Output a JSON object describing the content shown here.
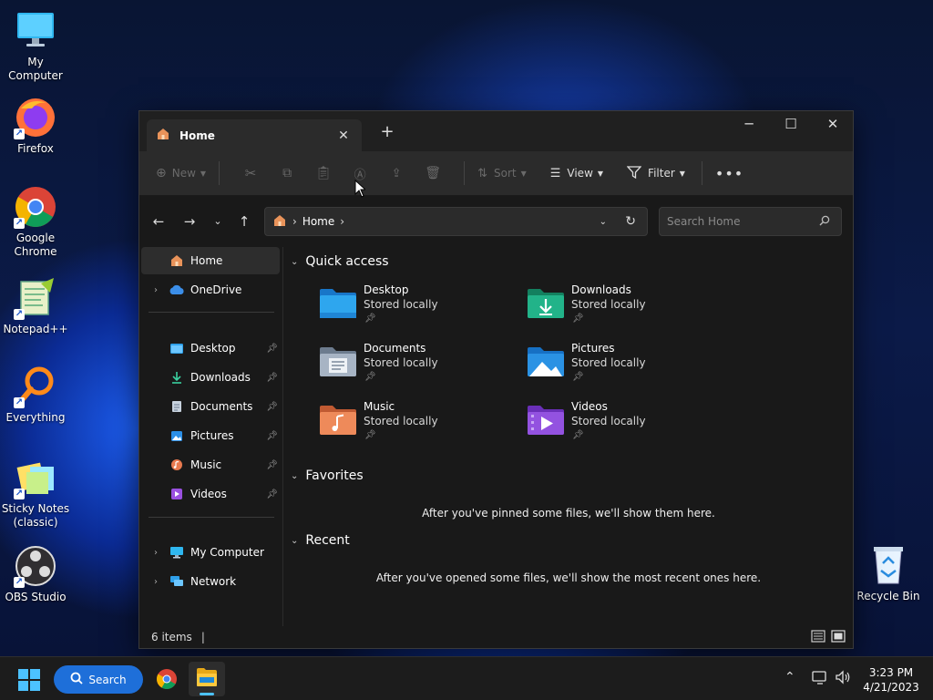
{
  "desktop": {
    "icons": [
      {
        "label": "My Computer",
        "icon": "computer-icon"
      },
      {
        "label": "Firefox",
        "icon": "firefox-icon"
      },
      {
        "label": "Google Chrome",
        "icon": "chrome-icon"
      },
      {
        "label": "Notepad++",
        "icon": "notepadpp-icon"
      },
      {
        "label": "Everything",
        "icon": "search-everything-icon"
      },
      {
        "label": "Sticky Notes (classic)",
        "icon": "sticky-notes-icon"
      },
      {
        "label": "OBS Studio",
        "icon": "obs-icon"
      },
      {
        "label": "Recycle Bin",
        "icon": "recycle-bin-icon"
      }
    ]
  },
  "window": {
    "tab_title": "Home",
    "toolbar": {
      "new_label": "New",
      "sort_label": "Sort",
      "view_label": "View",
      "filter_label": "Filter"
    },
    "address": {
      "path": "Home"
    },
    "search": {
      "placeholder": "Search Home"
    },
    "sidebar": {
      "top_items": [
        {
          "label": "Home",
          "icon": "home-icon",
          "selected": true
        },
        {
          "label": "OneDrive",
          "icon": "cloud-icon"
        }
      ],
      "pinned_items": [
        {
          "label": "Desktop",
          "icon": "desktop-folder-icon"
        },
        {
          "label": "Downloads",
          "icon": "download-icon"
        },
        {
          "label": "Documents",
          "icon": "documents-icon"
        },
        {
          "label": "Pictures",
          "icon": "pictures-icon"
        },
        {
          "label": "Music",
          "icon": "music-icon"
        },
        {
          "label": "Videos",
          "icon": "videos-icon"
        }
      ],
      "bottom_items": [
        {
          "label": "My Computer",
          "icon": "computer-icon"
        },
        {
          "label": "Network",
          "icon": "network-icon"
        }
      ]
    },
    "content": {
      "quick_access_title": "Quick access",
      "quick_access": [
        {
          "name": "Desktop",
          "sub": "Stored locally",
          "icon": "desktop-folder-icon",
          "color": "#2a9de8"
        },
        {
          "name": "Downloads",
          "sub": "Stored locally",
          "icon": "downloads-folder-icon",
          "color": "#1fa07a"
        },
        {
          "name": "Documents",
          "sub": "Stored locally",
          "icon": "documents-folder-icon",
          "color": "#8a9bb0"
        },
        {
          "name": "Pictures",
          "sub": "Stored locally",
          "icon": "pictures-folder-icon",
          "color": "#2a8de0"
        },
        {
          "name": "Music",
          "sub": "Stored locally",
          "icon": "music-folder-icon",
          "color": "#e0784a"
        },
        {
          "name": "Videos",
          "sub": "Stored locally",
          "icon": "videos-folder-icon",
          "color": "#8a4ad0"
        }
      ],
      "favorites_title": "Favorites",
      "favorites_empty": "After you've pinned some files, we'll show them here.",
      "recent_title": "Recent",
      "recent_empty": "After you've opened some files, we'll show the most recent ones here."
    },
    "status": {
      "items_count": "6 items"
    }
  },
  "taskbar": {
    "search_label": "Search",
    "time": "3:23 PM",
    "date": "4/21/2023"
  }
}
